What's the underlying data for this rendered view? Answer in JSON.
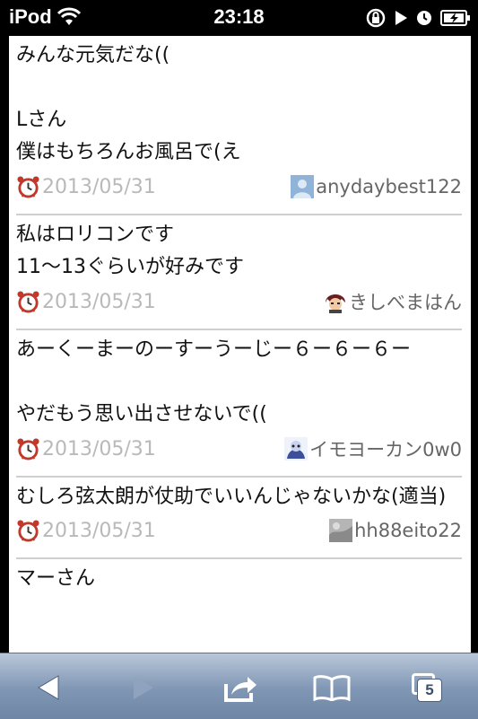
{
  "status_bar": {
    "carrier": "iPod",
    "time": "23:18",
    "wifi_icon": "wifi-icon",
    "orientation_lock_icon": "orientation-lock-icon",
    "play_icon": "play-icon",
    "alarm_icon": "alarm-icon",
    "battery_icon": "battery-charging-icon"
  },
  "posts": [
    {
      "lines": [
        "みんな元気だな((",
        "",
        "Lさん",
        "僕はもちろんお風呂で(え"
      ],
      "date": "2013/05/31",
      "user": "anydaybest122",
      "avatar": "default-person-avatar"
    },
    {
      "lines": [
        "私はロリコンです",
        "11〜13ぐらいが好みです"
      ],
      "date": "2013/05/31",
      "user": "きしべまはん",
      "avatar": "anime-character-avatar"
    },
    {
      "lines": [
        "あーくーまーのーすーうーじー６ー６ー６ー",
        "",
        "やだもう思い出させないで(("
      ],
      "date": "2013/05/31",
      "user": "イモヨーカン0w0",
      "avatar": "blue-character-avatar"
    },
    {
      "lines": [
        "むしろ弦太朗が仗助でいいんじゃないかな(適当)"
      ],
      "date": "2013/05/31",
      "user": "hh88eito22",
      "avatar": "gray-photo-avatar"
    },
    {
      "lines": [
        "マーさん"
      ],
      "date": "",
      "user": "",
      "avatar": ""
    }
  ],
  "toolbar": {
    "back_icon": "back-arrow-icon",
    "forward_icon": "forward-arrow-icon",
    "share_icon": "share-icon",
    "bookmarks_icon": "bookmarks-book-icon",
    "pages_icon": "pages-icon",
    "pages_count": "5"
  },
  "colors": {
    "toolbar_top": "#b9c7d9",
    "toolbar_bottom": "#6f86a6",
    "date_text": "#b9b9b9",
    "divider": "#cfcfcf"
  }
}
